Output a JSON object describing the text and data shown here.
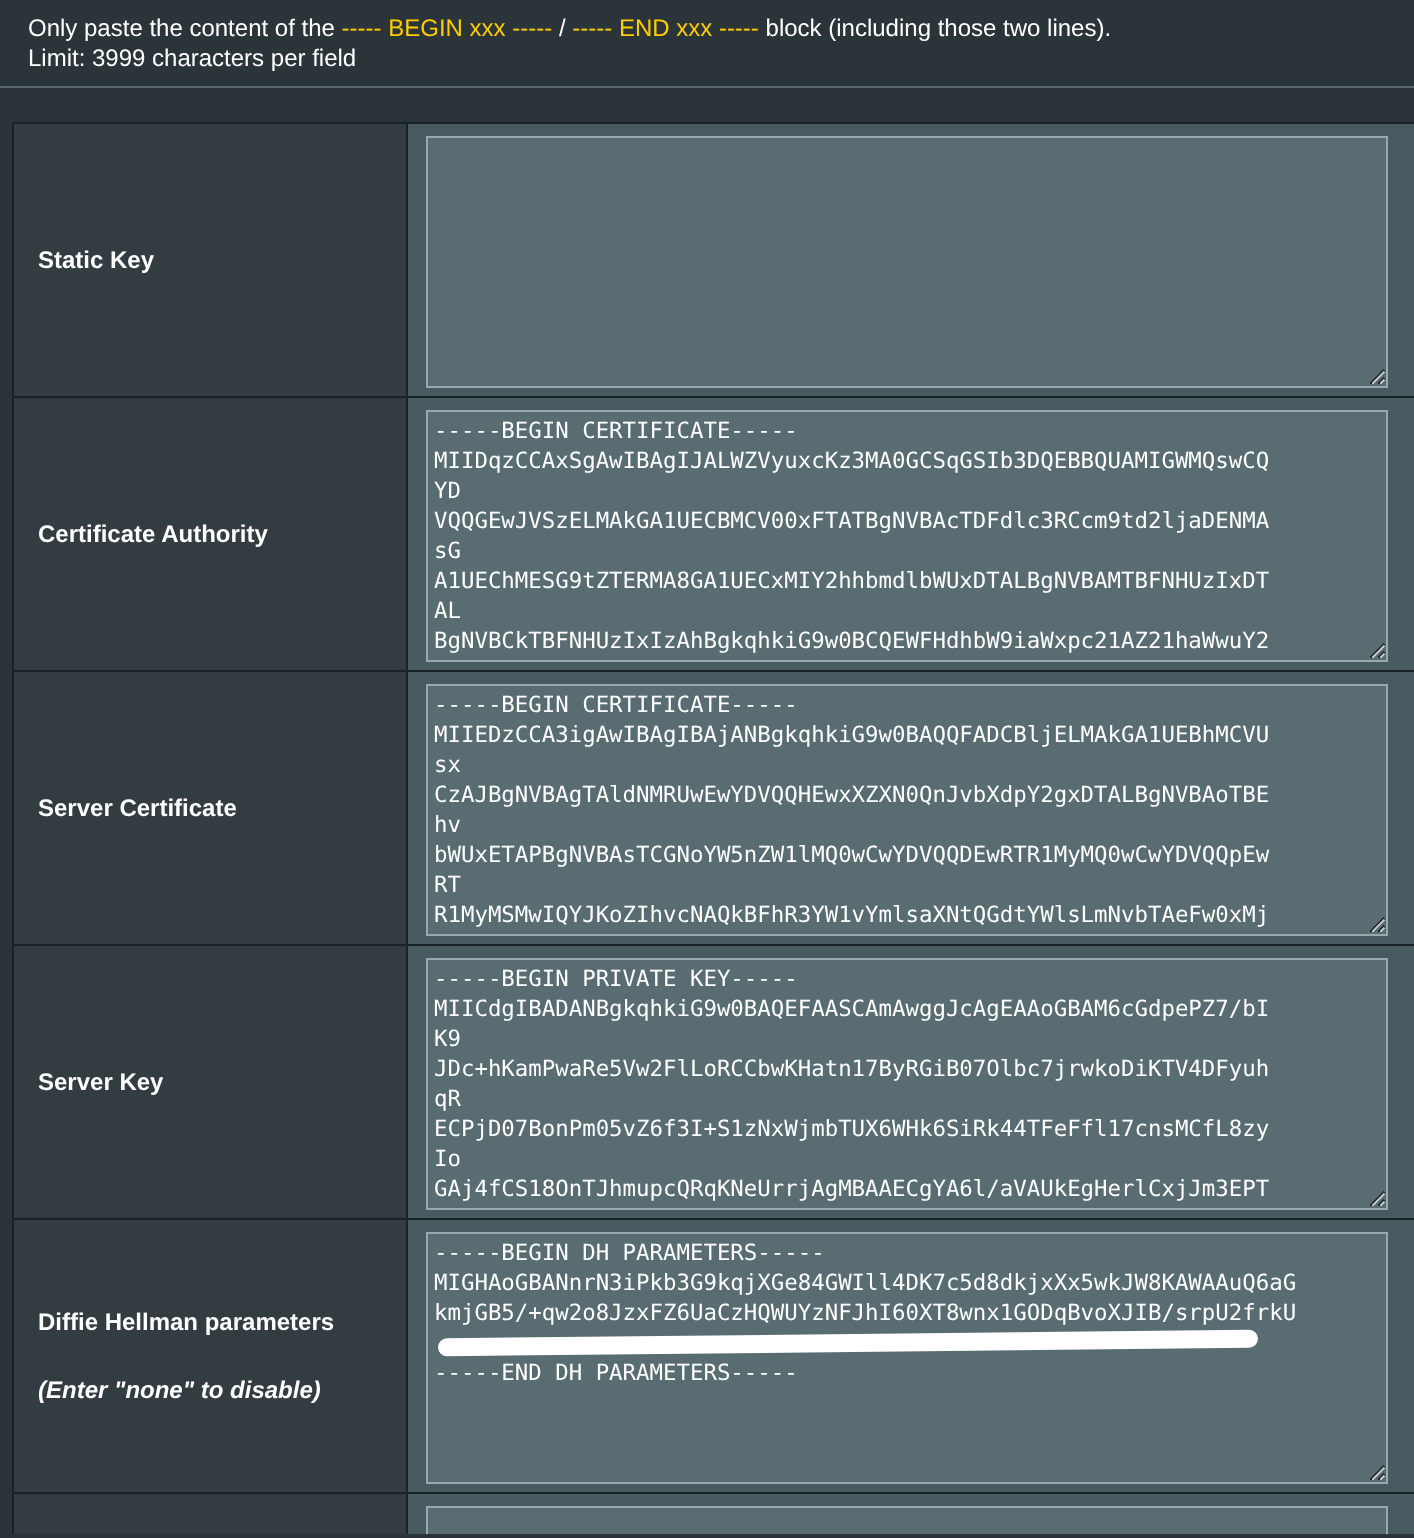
{
  "header": {
    "note": [
      {
        "text": "Only paste the content of the",
        "highlight": false
      },
      {
        "text": "----- BEGIN xxx -----",
        "highlight": true
      },
      {
        "text": "/",
        "highlight": false
      },
      {
        "text": "----- END xxx -----",
        "highlight": true
      },
      {
        "text": "block (including those two lines).",
        "highlight": false
      }
    ],
    "limit": "Limit: 3999 characters per field"
  },
  "rows": [
    {
      "label": "Static Key",
      "value": ""
    },
    {
      "label": "Certificate Authority",
      "value": "-----BEGIN CERTIFICATE-----\nMIIDqzCCAxSgAwIBAgIJALWZVyuxcKz3MA0GCSqGSIb3DQEBBQUAMIGWMQswCQ\nYD\nVQQGEwJVSzELMAkGA1UECBMCV00xFTATBgNVBAcTDFdlc3RCcm9td2ljaDENMA\nsG\nA1UEChMESG9tZTERMA8GA1UECxMIY2hhbmdlbWUxDTALBgNVBAMTBFNHUzIxDT\nAL\nBgNVBCkTBFNHUzIxIzAhBgkqhkiG9w0BCQEWFHdhbW9iaWxpc21AZ21haWwuY2"
    },
    {
      "label": "Server Certificate",
      "value": "-----BEGIN CERTIFICATE-----\nMIIEDzCCA3igAwIBAgIBAjANBgkqhkiG9w0BAQQFADCBljELMAkGA1UEBhMCVU\nsx\nCzAJBgNVBAgTAldNMRUwEwYDVQQHEwxXZXN0QnJvbXdpY2gxDTALBgNVBAoTBE\nhv\nbWUxETAPBgNVBAsTCGNoYW5nZW1lMQ0wCwYDVQQDEwRTR1MyMQ0wCwYDVQQpEw\nRT\nR1MyMSMwIQYJKoZIhvcNAQkBFhR3YW1vYmlsaXNtQGdtYWlsLmNvbTAeFw0xMj"
    },
    {
      "label": "Server Key",
      "value": "-----BEGIN PRIVATE KEY-----\nMIICdgIBADANBgkqhkiG9w0BAQEFAASCAmAwggJcAgEAAoGBAM6cGdpePZ7/bI\nK9\nJDc+hKamPwaRe5Vw2FlLoRCCbwKHatn17ByRGiB07Olbc7jrwkoDiKTV4DFyuh\nqR\nECPjD07BonPm05vZ6f3I+S1zNxWjmbTUX6WHk6SiRk44TFeFfl17cnsMCfL8zy\nIo\nGAj4fCS18OnTJhmupcQRqKNeUrrjAgMBAAECgYA6l/aVAUkEgHerlCxjJm3EPT"
    },
    {
      "label": "Diffie Hellman parameters",
      "hint": "(Enter \"none\" to disable)",
      "value": "-----BEGIN DH PARAMETERS-----\nMIGHAoGBANnrN3iPkb3G9kqjXGe84GWIll4DK7c5d8dkjxXx5wkJW8KAWAAuQ6aG\nkmjGB5/+qw2o8JzxFZ6UaCzHQWUYzNFJhI60XT8wnx1GODqBvoXJIB/srpU2frkU\n\n-----END DH PARAMETERS-----",
      "redacted": true
    },
    {
      "value": ""
    }
  ]
}
